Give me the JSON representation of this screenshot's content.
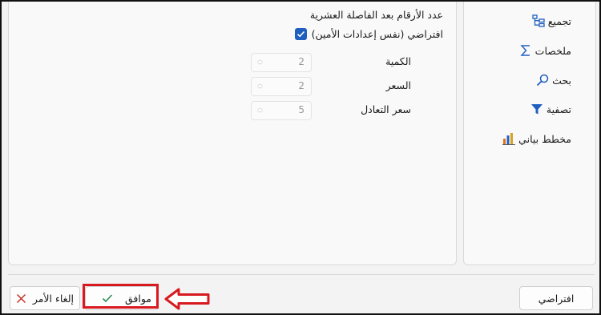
{
  "settings": {
    "section_title": "عدد الأرقام بعد الفاصلة العشرية",
    "default_checkbox_label": "افتراضي (نفس إعدادات الأمين)",
    "default_checked": true,
    "fields": [
      {
        "label": "الكمية",
        "value": "2"
      },
      {
        "label": "السعر",
        "value": "2"
      },
      {
        "label": "سعر التعادل",
        "value": "5"
      }
    ]
  },
  "sidebar": {
    "items": [
      {
        "label": "تجميع",
        "icon": "group-icon"
      },
      {
        "label": "ملخصات",
        "icon": "sigma-icon"
      },
      {
        "label": "بحث",
        "icon": "search-icon"
      },
      {
        "label": "تصفية",
        "icon": "filter-icon"
      },
      {
        "label": "مخطط بياني",
        "icon": "chart-icon"
      }
    ]
  },
  "footer": {
    "default_label": "افتراضي",
    "ok_label": "موافق",
    "cancel_label": "إلغاء الأمر"
  },
  "colors": {
    "accent": "#1f5fbf",
    "highlight": "#d8191f"
  }
}
